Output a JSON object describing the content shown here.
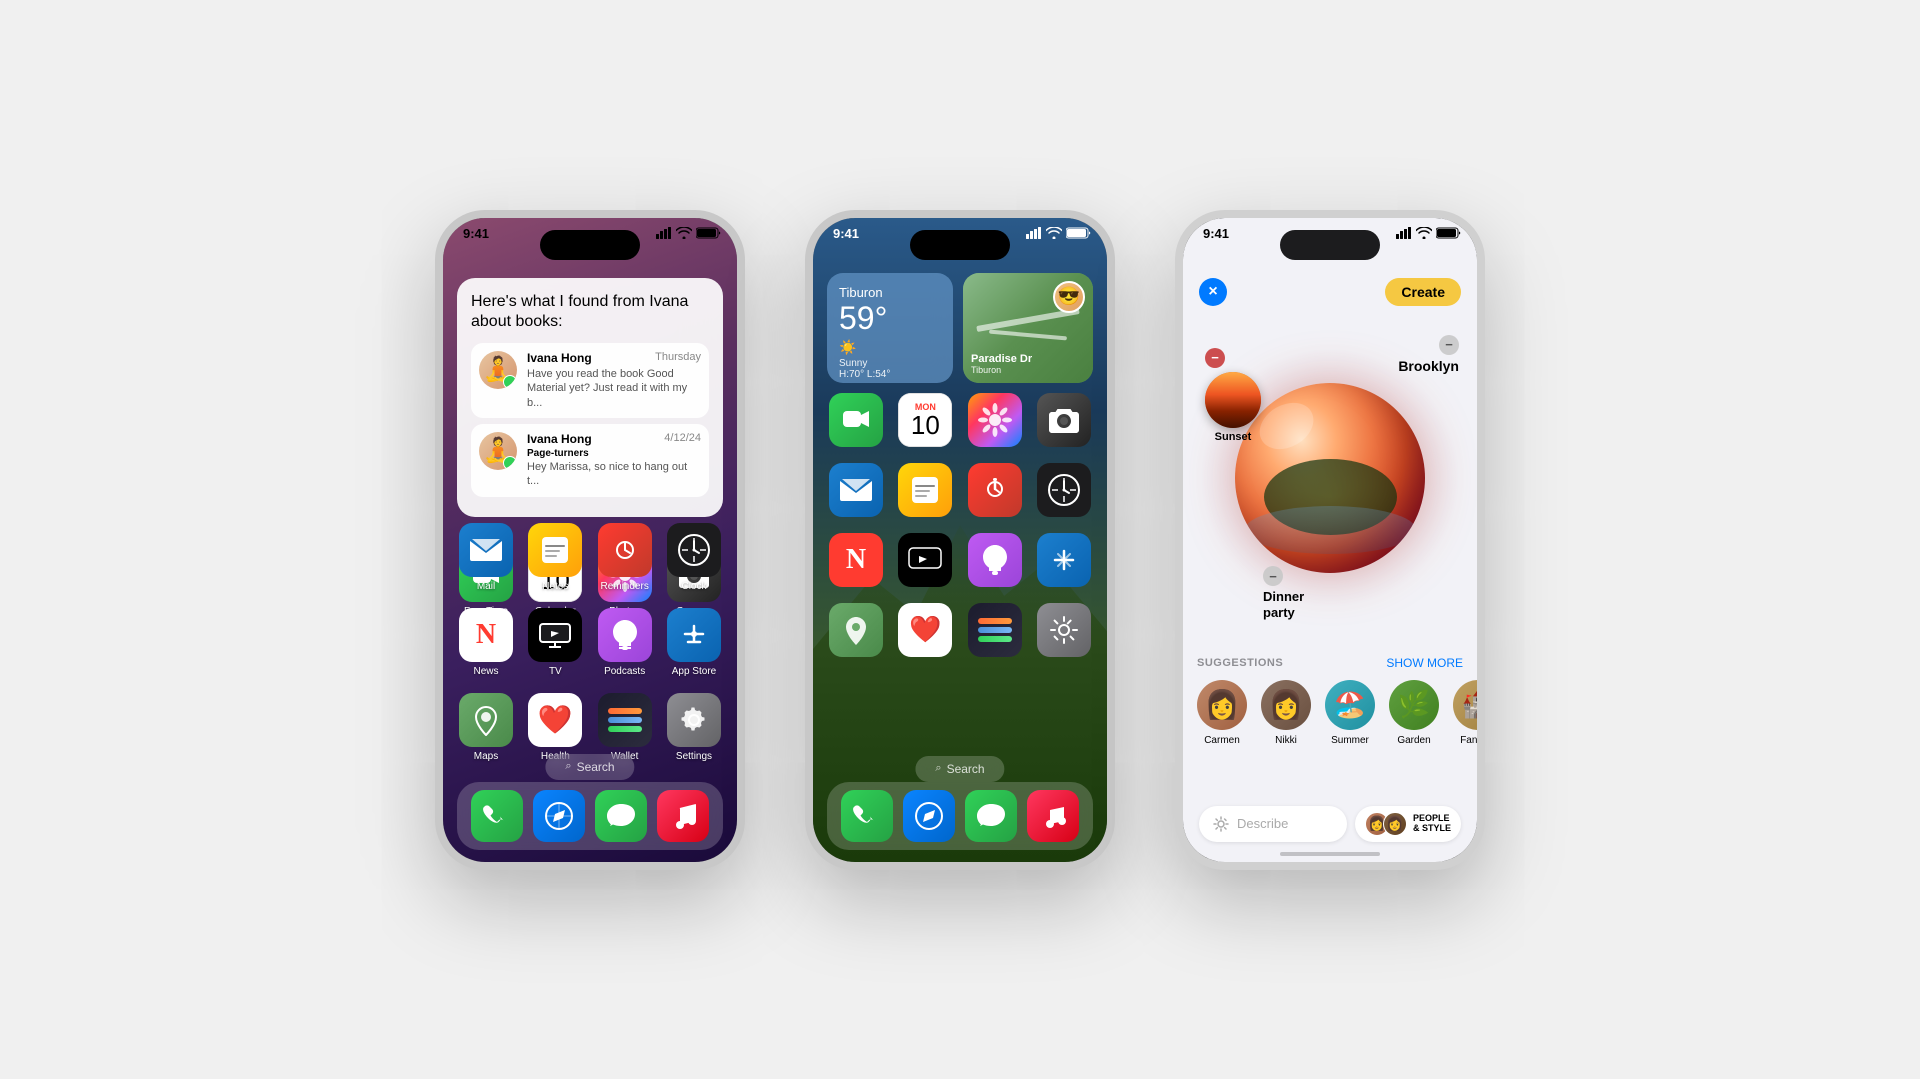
{
  "phone1": {
    "statusBar": {
      "time": "9:41"
    },
    "siri": {
      "headerText": "Here's what I found from Ivana about books:",
      "messages": [
        {
          "sender": "Ivana Hong",
          "date": "Thursday",
          "preview": "Have you read the book Good Material yet? Just read it with my b...",
          "avatar": "🧘"
        },
        {
          "sender": "Ivana Hong",
          "date": "4/12/24",
          "preview": "Hey Marissa, so nice to hang out t...",
          "subject": "Page-turners",
          "avatar": "🧘"
        }
      ]
    },
    "apps": [
      {
        "label": "Mail",
        "icon": "✉️",
        "style": "ic-mail"
      },
      {
        "label": "Notes",
        "icon": "📝",
        "style": "ic-notes"
      },
      {
        "label": "Reminders",
        "icon": "🔔",
        "style": "ic-reminders"
      },
      {
        "label": "Clock",
        "icon": "🕐",
        "style": "ic-clock"
      },
      {
        "label": "News",
        "icon": "N",
        "style": "ic-news"
      },
      {
        "label": "TV",
        "icon": "📺",
        "style": "ic-tv"
      },
      {
        "label": "Podcasts",
        "icon": "🎙️",
        "style": "ic-podcasts"
      },
      {
        "label": "App Store",
        "icon": "A",
        "style": "ic-appstore"
      },
      {
        "label": "Maps",
        "icon": "🗺️",
        "style": "ic-maps"
      },
      {
        "label": "Health",
        "icon": "❤️",
        "style": "ic-health"
      },
      {
        "label": "Wallet",
        "icon": "💳",
        "style": "ic-wallet"
      },
      {
        "label": "Settings",
        "icon": "⚙️",
        "style": "ic-settings"
      }
    ],
    "dock": [
      {
        "label": "Phone",
        "style": "ic-phone"
      },
      {
        "label": "Safari",
        "style": "ic-safari"
      },
      {
        "label": "Messages",
        "style": "ic-messages"
      },
      {
        "label": "Music",
        "style": "ic-music"
      }
    ],
    "search": "Search"
  },
  "phone2": {
    "statusBar": {
      "time": "9:41"
    },
    "weather": {
      "city": "Tiburon",
      "temp": "59°",
      "condition": "Sunny",
      "high": "H:70°",
      "low": "L:54°"
    },
    "maps": {
      "street": "Paradise Dr",
      "city": "Tiburon"
    },
    "appRows": [
      [
        {
          "label": "FaceTime",
          "style": "ic2-facetime",
          "icon": "📹"
        },
        {
          "label": "Calendar",
          "style": "ic2-calendar",
          "icon": "cal",
          "month": "MON",
          "day": "10"
        },
        {
          "label": "Photos",
          "style": "ic-photos",
          "icon": "🌈"
        },
        {
          "label": "Camera",
          "style": "ic-camera",
          "icon": "📷"
        }
      ],
      [
        {
          "label": "Mail",
          "style": "ic2-mail",
          "icon": "✉️"
        },
        {
          "label": "Notes",
          "style": "ic-notes",
          "icon": "📝"
        },
        {
          "label": "Reminders",
          "style": "ic2-reminders",
          "icon": "🔴"
        },
        {
          "label": "Clock",
          "style": "ic2-clock",
          "icon": "clock"
        }
      ],
      [
        {
          "label": "News",
          "style": "ic2-news",
          "icon": "N"
        },
        {
          "label": "Apple TV",
          "style": "ic2-appletv",
          "icon": "tv"
        },
        {
          "label": "Podcasts",
          "style": "ic2-podcasts",
          "icon": "🎙️"
        },
        {
          "label": "App Store",
          "style": "ic2-appstore",
          "icon": "A"
        }
      ],
      [
        {
          "label": "Maps",
          "style": "ic2-maps",
          "icon": "🗺️"
        },
        {
          "label": "Health",
          "style": "ic2-health",
          "icon": "❤️"
        },
        {
          "label": "Wallet",
          "style": "ic2-wallet",
          "icon": "💳"
        },
        {
          "label": "Settings",
          "style": "ic2-settings",
          "icon": "⚙️"
        }
      ]
    ],
    "dock": [
      {
        "label": "Phone",
        "style": "ic-phone"
      },
      {
        "label": "Safari",
        "style": "ic-safari"
      },
      {
        "label": "Messages",
        "style": "ic-messages"
      },
      {
        "label": "Music",
        "style": "ic-music"
      }
    ],
    "search": "Search"
  },
  "phone3": {
    "statusBar": {
      "time": "9:41"
    },
    "closeBtn": "×",
    "createBtn": "Create",
    "bubbles": [
      {
        "name": "Brooklyn"
      },
      {
        "name": "Sunset"
      },
      {
        "name": "Dinner party"
      }
    ],
    "suggestions": {
      "title": "SUGGESTIONS",
      "showMore": "SHOW MORE",
      "items": [
        {
          "label": "Carmen",
          "style": "sug-carmen",
          "icon": "👩"
        },
        {
          "label": "Nikki",
          "style": "sug-nikki",
          "icon": "👩"
        },
        {
          "label": "Summer",
          "style": "sug-summer",
          "icon": "🏖️"
        },
        {
          "label": "Garden",
          "style": "sug-garden",
          "icon": "🌿"
        },
        {
          "label": "Fantasy",
          "style": "sug-fantasy",
          "icon": "🏰"
        }
      ]
    },
    "describe": {
      "placeholder": "Describe",
      "peopleStyle": "PEOPLE\n& STYLE"
    }
  }
}
